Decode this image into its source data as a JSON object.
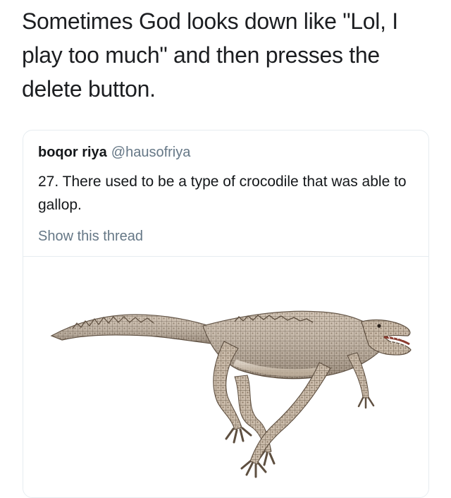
{
  "caption": {
    "text": "Sometimes God looks down like \"Lol, I play too much\" and then presses the delete button."
  },
  "tweet": {
    "author_name": "boqor riya",
    "author_handle": "@hausofriya",
    "text": "27. There used to be a type of crocodile that was able to gallop.",
    "show_thread_label": "Show this thread"
  },
  "media": {
    "subject": "galloping-crocodile-illustration"
  }
}
